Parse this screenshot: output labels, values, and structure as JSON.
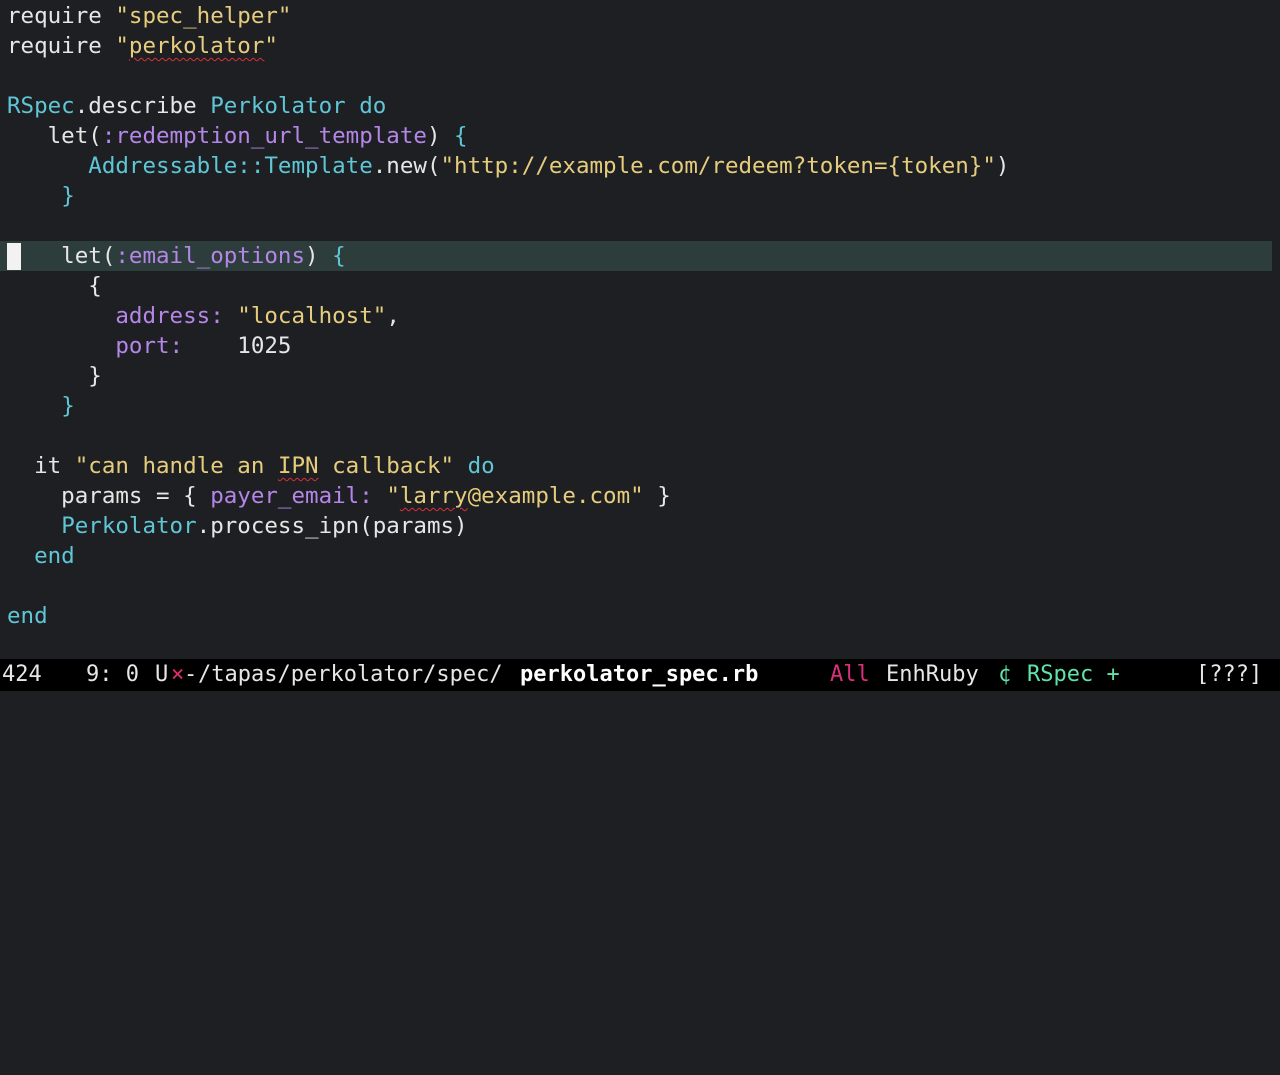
{
  "editor": {
    "cursor_line": 9,
    "lines": [
      [
        {
          "t": "require ",
          "c": "plain"
        },
        {
          "t": "\"spec_helper\"",
          "c": "string"
        }
      ],
      [
        {
          "t": "require ",
          "c": "plain"
        },
        {
          "t": "\"",
          "c": "string"
        },
        {
          "t": "perkolator",
          "c": "string",
          "spell": true
        },
        {
          "t": "\"",
          "c": "string"
        }
      ],
      [],
      [
        {
          "t": "RSpec",
          "c": "const"
        },
        {
          "t": ".describe ",
          "c": "plain"
        },
        {
          "t": "Perkolator",
          "c": "const"
        },
        {
          "t": " ",
          "c": "plain"
        },
        {
          "t": "do",
          "c": "kw"
        }
      ],
      [
        {
          "t": "   let(",
          "c": "plain"
        },
        {
          "t": ":redemption_url_template",
          "c": "sym"
        },
        {
          "t": ") ",
          "c": "plain"
        },
        {
          "t": "{",
          "c": "kw"
        }
      ],
      [
        {
          "t": "      ",
          "c": "plain"
        },
        {
          "t": "Addressable::Template",
          "c": "const"
        },
        {
          "t": ".new(",
          "c": "plain"
        },
        {
          "t": "\"http://example.com/redeem?token={token}\"",
          "c": "string"
        },
        {
          "t": ")",
          "c": "plain"
        }
      ],
      [
        {
          "t": "    ",
          "c": "plain"
        },
        {
          "t": "}",
          "c": "kw"
        }
      ],
      [],
      [
        {
          "t": "    let(",
          "c": "plain"
        },
        {
          "t": ":email_options",
          "c": "sym"
        },
        {
          "t": ") ",
          "c": "plain"
        },
        {
          "t": "{",
          "c": "kw"
        }
      ],
      [
        {
          "t": "      {",
          "c": "plain"
        }
      ],
      [
        {
          "t": "        ",
          "c": "plain"
        },
        {
          "t": "address:",
          "c": "sym"
        },
        {
          "t": " ",
          "c": "plain"
        },
        {
          "t": "\"localhost\"",
          "c": "string"
        },
        {
          "t": ",",
          "c": "plain"
        }
      ],
      [
        {
          "t": "        ",
          "c": "plain"
        },
        {
          "t": "port:",
          "c": "sym"
        },
        {
          "t": "    1025",
          "c": "num"
        }
      ],
      [
        {
          "t": "      }",
          "c": "plain"
        }
      ],
      [
        {
          "t": "    ",
          "c": "plain"
        },
        {
          "t": "}",
          "c": "kw"
        }
      ],
      [],
      [
        {
          "t": "  it ",
          "c": "plain"
        },
        {
          "t": "\"can handle an ",
          "c": "string"
        },
        {
          "t": "IPN",
          "c": "string",
          "spell": true
        },
        {
          "t": " callback\"",
          "c": "string"
        },
        {
          "t": " ",
          "c": "plain"
        },
        {
          "t": "do",
          "c": "kw"
        }
      ],
      [
        {
          "t": "    params = { ",
          "c": "plain"
        },
        {
          "t": "payer_email:",
          "c": "sym"
        },
        {
          "t": " ",
          "c": "plain"
        },
        {
          "t": "\"",
          "c": "string"
        },
        {
          "t": "larry",
          "c": "string",
          "spell": true
        },
        {
          "t": "@example.com\"",
          "c": "string"
        },
        {
          "t": " }",
          "c": "plain"
        }
      ],
      [
        {
          "t": "    ",
          "c": "plain"
        },
        {
          "t": "Perkolator",
          "c": "const"
        },
        {
          "t": ".process_ipn(params)",
          "c": "plain"
        }
      ],
      [
        {
          "t": "  ",
          "c": "plain"
        },
        {
          "t": "end",
          "c": "kw"
        }
      ],
      [],
      [
        {
          "t": "end",
          "c": "kw"
        }
      ]
    ]
  },
  "modeline": {
    "line_count": "424",
    "position": "9: 0",
    "encoding_flag": "U",
    "modified_flag": "×",
    "dash": "-",
    "path": "/tapas/perkolator/spec/",
    "filename": "perkolator_spec.rb",
    "scroll": "All",
    "major_mode": "EnhRuby",
    "mode_separator": "¢",
    "minor_mode": "RSpec +",
    "status": "[???]"
  },
  "colors": {
    "background": "#1e1f22",
    "highlight_line": "#2c3d3b",
    "string": "#e6cd7d",
    "constant": "#5fc6d6",
    "symbol": "#b486e8",
    "modeline_bg": "#000000",
    "modified_marker": "#e0306a",
    "mode_text": "#5fe3a8"
  }
}
